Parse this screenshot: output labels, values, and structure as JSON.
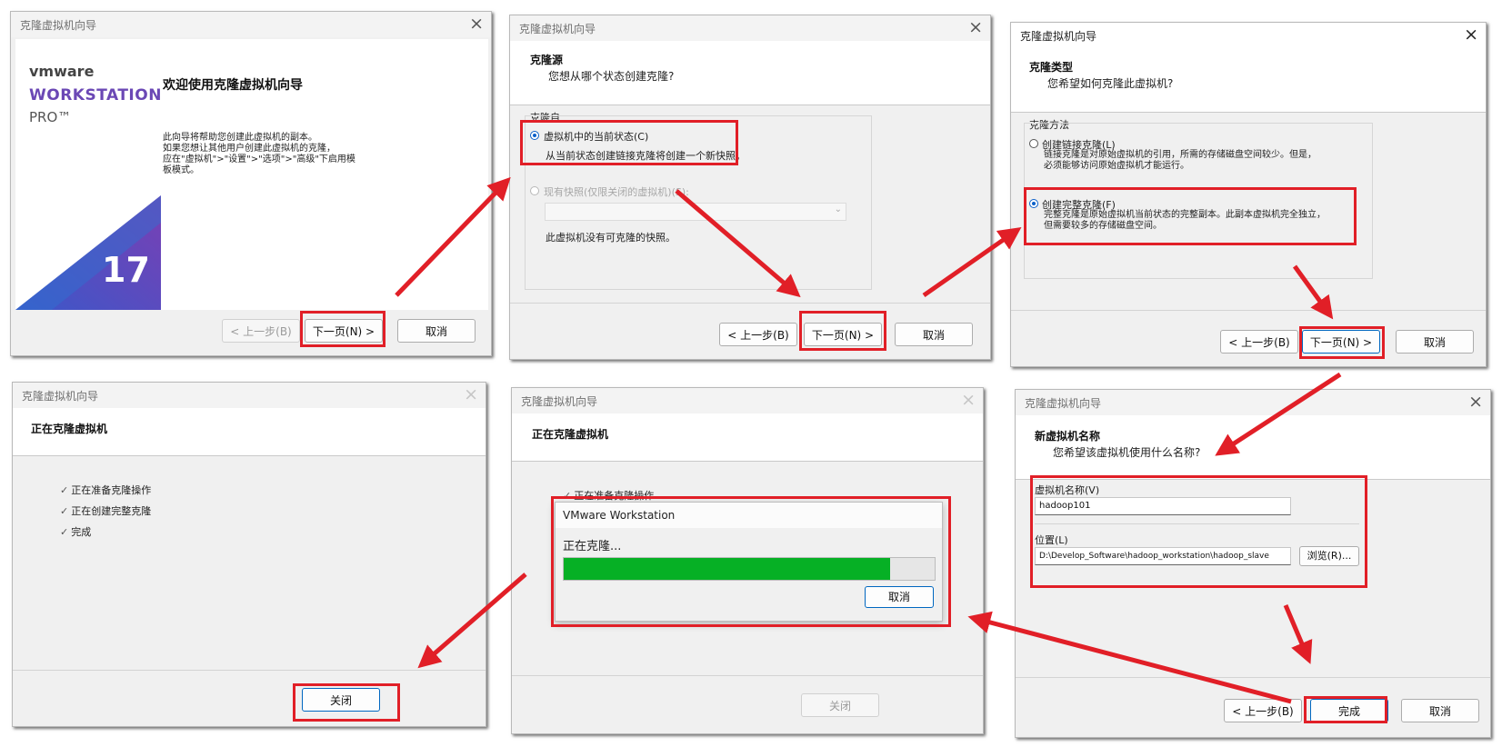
{
  "colors": {
    "highlight": "#e11f27",
    "progress": "#06b025",
    "accent": "#0067c0",
    "logo_purple": "#6b48b5"
  },
  "welcome": {
    "title": "克隆虚拟机向导",
    "logo_vm": "vmware",
    "logo_ws": "WORKSTATION",
    "logo_pro": "PRO™",
    "logo_ver": "17",
    "heading": "欢迎使用克隆虚拟机向导",
    "body": [
      "此向导将帮助您创建此虚拟机的副本。",
      "如果您想让其他用户创建此虚拟机的克隆，",
      "应在\"虚拟机\">\"设置\">\"选项\">\"高级\"下启用模",
      "板模式。"
    ],
    "back": "< 上一步(B)",
    "next": "下一页(N) >",
    "cancel": "取消"
  },
  "source": {
    "title": "克隆虚拟机向导",
    "h1": "克隆源",
    "h2": "您想从哪个状态创建克隆?",
    "group_label": "克隆自",
    "opt1": "虚拟机中的当前状态(C)",
    "opt1_desc": "从当前状态创建链接克隆将创建一个新快照。",
    "opt2": "现有快照(仅限关闭的虚拟机)(S):",
    "no_snapshot": "此虚拟机没有可克隆的快照。",
    "back": "< 上一步(B)",
    "next": "下一页(N) >",
    "cancel": "取消"
  },
  "type": {
    "title": "克隆虚拟机向导",
    "h1": "克隆类型",
    "h2": "您希望如何克隆此虚拟机?",
    "group_label": "克隆方法",
    "opt1": "创建链接克隆(L)",
    "opt1_desc": [
      "链接克隆是对原始虚拟机的引用，所需的存储磁盘空间较少。但是，",
      "必须能够访问原始虚拟机才能运行。"
    ],
    "opt2": "创建完整克隆(F)",
    "opt2_desc": [
      "完整克隆是原始虚拟机当前状态的完整副本。此副本虚拟机完全独立，",
      "但需要较多的存储磁盘空间。"
    ],
    "back": "< 上一步(B)",
    "next": "下一页(N) >",
    "cancel": "取消"
  },
  "name": {
    "title": "克隆虚拟机向导",
    "h1": "新虚拟机名称",
    "h2": "您希望该虚拟机使用什么名称?",
    "vm_name_label": "虚拟机名称(V)",
    "vm_name_value": "hadoop101",
    "location_label": "位置(L)",
    "location_value": "D:\\Develop_Software\\hadoop_workstation\\hadoop_slave",
    "browse": "浏览(R)...",
    "back": "< 上一步(B)",
    "finish": "完成",
    "cancel": "取消"
  },
  "progress": {
    "title": "克隆虚拟机向导",
    "h1": "正在克隆虚拟机",
    "step_partial": "正在准备克隆操作",
    "popup_title": "VMware Workstation",
    "popup_msg": "正在克隆...",
    "popup_progress": 0.88,
    "popup_cancel": "取消",
    "close": "关闭"
  },
  "done": {
    "title": "克隆虚拟机向导",
    "h1": "正在克隆虚拟机",
    "steps": [
      "正在准备克隆操作",
      "正在创建完整克隆",
      "完成"
    ],
    "close": "关闭"
  }
}
